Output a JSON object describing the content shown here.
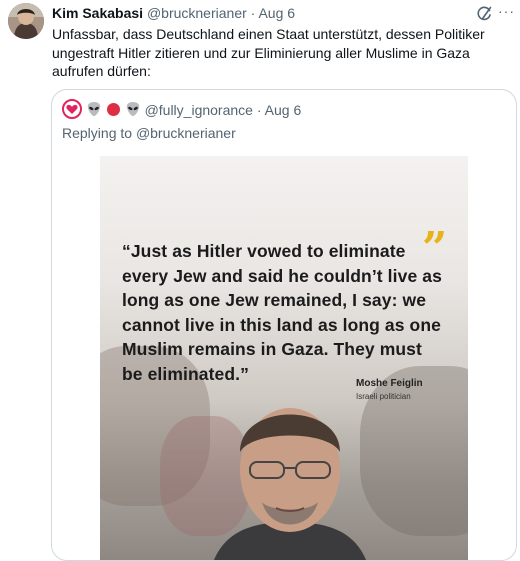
{
  "tweet": {
    "author_name": "Kim Sakabasi",
    "author_handle": "@brucknerianer",
    "separator": "·",
    "date": "Aug 6",
    "text": "Unfassbar, dass Deutschland einen Staat unterstützt, dessen Politiker ungestraft Hitler zitieren und zur Eliminierung aller Muslime in Gaza aufrufen dürfen:",
    "more_label": "···"
  },
  "quoted_tweet": {
    "emojis": [
      "heart-in-shield",
      "alien",
      "red-circle",
      "alien"
    ],
    "handle": "@fully_ignorance",
    "separator": "·",
    "date": "Aug 6",
    "replying_prefix": "Replying to",
    "replying_handle": "@brucknerianer",
    "image": {
      "quote": "“Just as Hitler vowed to eliminate every Jew and said he couldn’t live as long as one Jew remained, I say: we cannot live in this land as long as one Muslim remains in Gaza. They must be eliminated.”",
      "quote_mark": "”",
      "attribution_name": "Moshe Feiglin",
      "attribution_role": "Israeli politician",
      "accent_color": "#e8b31a"
    }
  },
  "colors": {
    "text_primary": "#0f1419",
    "text_secondary": "#536471",
    "border": "#cfd9de"
  }
}
